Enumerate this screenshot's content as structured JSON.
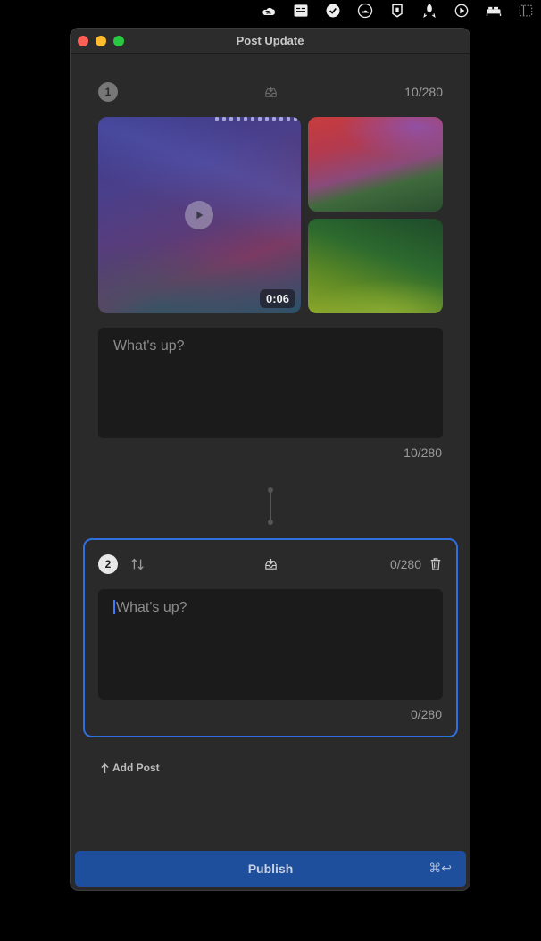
{
  "menubar": {
    "icons": [
      "cloud-swirl-icon",
      "finder-like-icon",
      "checkmark-circle-icon",
      "cloud-icon",
      "shield-tag-icon",
      "rocket-icon",
      "play-circle-icon",
      "bed-icon",
      "window-dots-icon"
    ]
  },
  "window": {
    "title": "Post Update",
    "traffic_colors": {
      "close": "#fe5f57",
      "minimize": "#febc2e",
      "maximize": "#28c840"
    }
  },
  "post1": {
    "number": "1",
    "counter_top": "10/280",
    "media": {
      "video_duration": "0:06"
    },
    "placeholder": "What's up?",
    "counter_bottom": "10/280"
  },
  "post2": {
    "number": "2",
    "counter_top": "0/280",
    "placeholder": "What's up?",
    "counter_bottom": "0/280",
    "accent_color": "#2f6fe0"
  },
  "actions": {
    "add_post": "Add Post",
    "publish": "Publish",
    "publish_shortcut": "⌘↩",
    "publish_color": "#1e4f9c"
  }
}
